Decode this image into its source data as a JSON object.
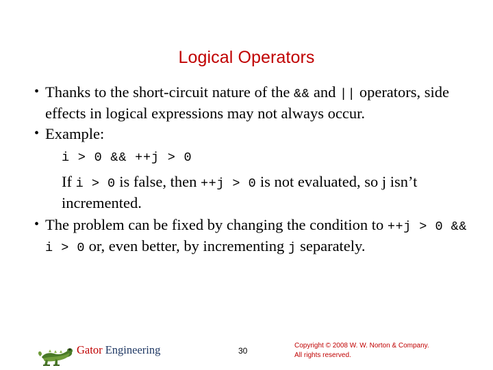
{
  "slide": {
    "title": "Logical Operators",
    "bullets": [
      {
        "parts": [
          {
            "t": "Thanks to the short-circuit nature of the ",
            "mono": false
          },
          {
            "t": "&&",
            "mono": true
          },
          {
            "t": " and ",
            "mono": false
          },
          {
            "t": "||",
            "mono": true
          },
          {
            "t": " operators, side effects in logical expressions may not always occur.",
            "mono": false
          }
        ]
      },
      {
        "parts": [
          {
            "t": "Example:",
            "mono": false
          }
        ]
      }
    ],
    "code_line": "i > 0 && ++j > 0",
    "explanation_parts": [
      {
        "t": "If ",
        "mono": false
      },
      {
        "t": "i > 0",
        "mono": true
      },
      {
        "t": " is false, then ",
        "mono": false
      },
      {
        "t": "++j > 0",
        "mono": true
      },
      {
        "t": " is not evaluated, so j isn’t incremented.",
        "mono": false
      }
    ],
    "last_bullet_parts": [
      {
        "t": "The problem can be fixed by changing the condition to ",
        "mono": false
      },
      {
        "t": "++j > 0 && i > 0",
        "mono": true
      },
      {
        "t": " or, even better, by incrementing ",
        "mono": false
      },
      {
        "t": "j",
        "mono": true
      },
      {
        "t": " separately.",
        "mono": false
      }
    ],
    "bullet_marker": "•"
  },
  "footer": {
    "brand_first": "Gator",
    "brand_second": " Engineering",
    "slide_number": "30",
    "copyright_line1": "Copyright © 2008 W. W. Norton & Company.",
    "copyright_line2": "All rights reserved."
  }
}
